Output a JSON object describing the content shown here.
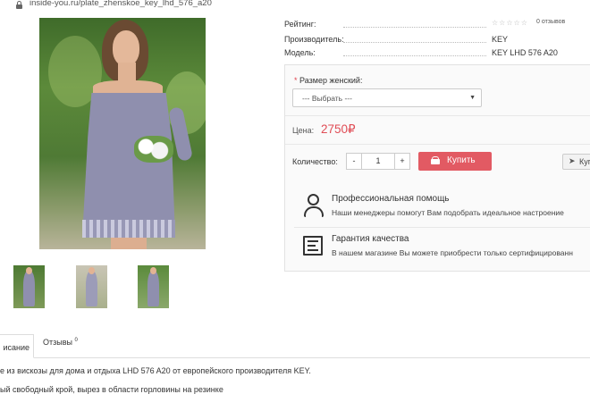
{
  "browser": {
    "url": "inside-you.ru/plate_zhenskoe_key_lhd_576_a20"
  },
  "gallery": {
    "thumbnails": [
      "thumb-1",
      "thumb-2",
      "thumb-3"
    ]
  },
  "specs": {
    "rating_label": "Рейтинг:",
    "rating_stars": "☆☆☆☆☆",
    "rating_reviews": "0 отзывов",
    "manufacturer_label": "Производитель:",
    "manufacturer_value": "KEY",
    "model_label": "Модель:",
    "model_value": "KEY LHD 576 A20"
  },
  "options": {
    "size_label": "Размер женский:",
    "size_required_mark": "*",
    "size_select_value": "--- Выбрать ---"
  },
  "price": {
    "label": "Цена:",
    "value": "2750₽"
  },
  "purchase": {
    "qty_label": "Количество:",
    "qty_minus": "-",
    "qty_value": "1",
    "qty_plus": "+",
    "buy_label": "Купить",
    "ask_label": "Куп"
  },
  "features": [
    {
      "title": "Профессиональная помощь",
      "desc": "Наши менеджеры помогут Вам подобрать идеальное настроение"
    },
    {
      "title": "Гарантия качества",
      "desc": "В нашем магазине Вы можете приобрести только сертифицированн"
    }
  ],
  "tabs": {
    "description": "исание",
    "reviews": "Отзывы",
    "reviews_count": "0"
  },
  "description": {
    "line1": "е из вискозы для дома и отдыха LHD 576 A20 от европейского производителя KEY.",
    "line2": "ый свободный крой, вырез в области горловины на резинке"
  },
  "colors": {
    "accent": "#e25a63",
    "price": "#e04d56"
  }
}
